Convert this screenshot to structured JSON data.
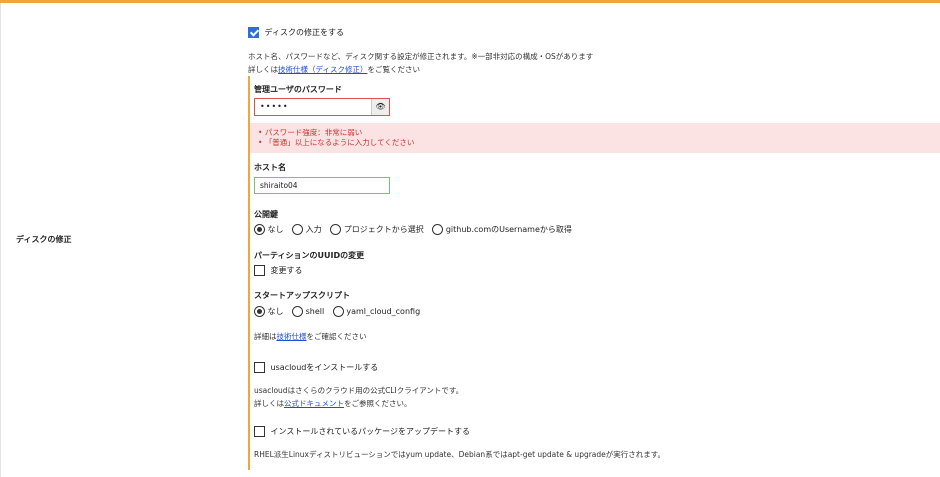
{
  "row_label": "ディスクの修正",
  "disk_edit": {
    "checkbox_label": "ディスクの修正をする",
    "checked": true,
    "desc_line1": "ホスト名、パスワードなど、ディスク関する設定が修正されます。※一部非対応の構成・OSがあります",
    "desc_line2_prefix": "詳しくは",
    "desc_link": "技術仕様（ディスク修正）",
    "desc_line2_suffix": "をご覧ください"
  },
  "password": {
    "label": "管理ユーザのパスワード",
    "value": "•••••",
    "toggle_icon": "eye-icon",
    "errors": [
      "パスワード強度：非常に弱い",
      "「普通」以上になるように入力してください"
    ]
  },
  "hostname": {
    "label": "ホスト名",
    "value": "shiraito04"
  },
  "public_key": {
    "label": "公開鍵",
    "options": [
      "なし",
      "入力",
      "プロジェクトから選択",
      "github.comのUsernameから取得"
    ],
    "selected": 0
  },
  "partition_uuid": {
    "label": "パーティションのUUIDの変更",
    "checkbox_label": "変更する",
    "checked": false
  },
  "startup_script": {
    "label": "スタートアップスクリプト",
    "options": [
      "なし",
      "shell",
      "yaml_cloud_config"
    ],
    "selected": 0,
    "note_prefix": "詳細は",
    "note_link": "技術仕様",
    "note_suffix": "をご確認ください"
  },
  "usacloud": {
    "checkbox_label": "usacloudをインストールする",
    "checked": false,
    "desc_line1": "usacloudはさくらのクラウド用の公式CLIクライアントです。",
    "desc_line2_prefix": "詳しくは",
    "desc_link": "公式ドキュメント",
    "desc_line2_suffix": "をご参照ください。"
  },
  "package_update": {
    "checkbox_label": "インストールされているパッケージをアップデートする",
    "checked": false,
    "desc": "RHEL派生Linuxディストリビューションではyum update、Debian系ではapt-get update & upgradeが実行されます。"
  },
  "colors": {
    "accent": "#f0a63a",
    "checkbox_checked": "#2a6fdb",
    "error_bg": "#fbe3e3",
    "error_text": "#cc3333",
    "link": "#1a4fd8"
  }
}
